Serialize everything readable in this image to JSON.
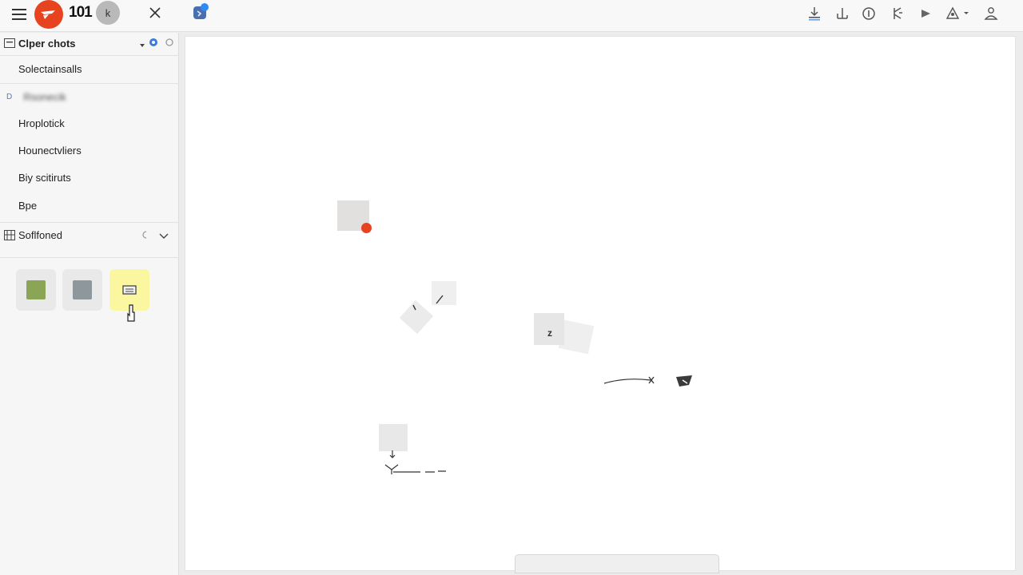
{
  "topbar": {
    "brand": "101",
    "avatar_initial": "k",
    "icons": {
      "menu": "hamburger-icon",
      "logo": "logo-icon",
      "close": "close-icon",
      "app": "app-icon",
      "right": [
        "download-icon",
        "anchor-icon",
        "info-icon",
        "branch-icon",
        "play-icon",
        "share-icon",
        "person-icon"
      ]
    }
  },
  "sidebar": {
    "section1": {
      "title": "Clper chots"
    },
    "items": [
      {
        "label": "Solectainsalls"
      },
      {
        "label": "Hroplotick"
      },
      {
        "label": "Hounectvliers"
      },
      {
        "label": "Biy scitiruts"
      },
      {
        "label": "Bpe"
      }
    ],
    "blurred_item": {
      "marker": "D",
      "label": "Rsonecik"
    },
    "section2": {
      "title": "Soflfoned"
    },
    "swatches": [
      {
        "name": "green",
        "color": "#8aa556"
      },
      {
        "name": "gray",
        "color": "#8e979c"
      },
      {
        "name": "highlight",
        "color": "#fbf7a0"
      }
    ]
  },
  "canvas": {
    "accent_color": "#e8431f",
    "node_glyph": "z"
  }
}
